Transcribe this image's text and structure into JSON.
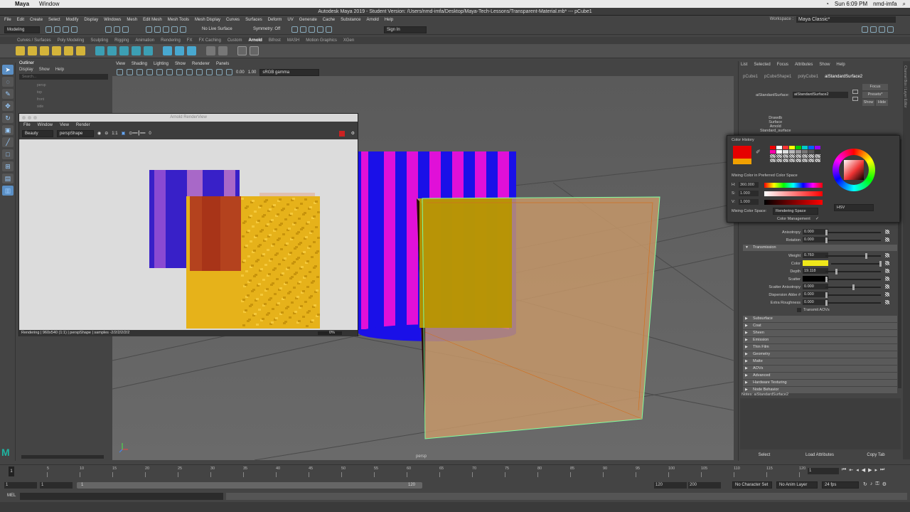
{
  "mac_menu": {
    "apple": "",
    "app": "Maya",
    "window": "Window",
    "clock": "Sun 6:09 PM",
    "user": "nmd-imfa"
  },
  "window_title": "Autodesk Maya 2019 - Student Version: /Users/nmd-imfa/Desktop/Maya-Tech-Lessons/Transparent-Material.mb*  ---  pCube1",
  "main_menu": [
    "File",
    "Edit",
    "Create",
    "Select",
    "Modify",
    "Display",
    "Windows",
    "Mesh",
    "Edit Mesh",
    "Mesh Tools",
    "Mesh Display",
    "Curves",
    "Surfaces",
    "Deform",
    "UV",
    "Generate",
    "Cache",
    "Substance",
    "Arnold",
    "Help"
  ],
  "workspace": {
    "label": "Workspace :",
    "value": "Maya Classic*"
  },
  "status_line": {
    "mode": "Modeling",
    "live_surface": "No Live Surface",
    "symmetry": "Symmetry: Off",
    "sign_in": "Sign In"
  },
  "shelf_tabs": [
    "Curves / Surfaces",
    "Poly Modeling",
    "Sculpting",
    "Rigging",
    "Animation",
    "Rendering",
    "FX",
    "FX Caching",
    "Custom",
    "Arnold",
    "Bifrost",
    "MASH",
    "Motion Graphics",
    "XGen"
  ],
  "shelf_active": "Arnold",
  "outliner": {
    "title": "Outliner",
    "menu": [
      "Display",
      "Show",
      "Help"
    ],
    "search": "Search...",
    "items": [
      "persp",
      "top",
      "front",
      "side"
    ]
  },
  "viewport": {
    "menu": [
      "View",
      "Shading",
      "Lighting",
      "Show",
      "Renderer",
      "Panels"
    ],
    "exposure": "0.00",
    "gamma": "1.00",
    "color_space": "sRGB gamma",
    "camera_label": "persp"
  },
  "render_view": {
    "title": "Arnold RenderView",
    "menu": [
      "File",
      "Window",
      "View",
      "Render"
    ],
    "aov": "Beauty",
    "camera": "perspShape",
    "ratio": "1:1",
    "exposure": "0",
    "status": "Rendering | 960x540 (1:1) | perspShape  | samples -2/2/2/2/2/2",
    "progress": "0%"
  },
  "attribute_editor": {
    "menu": [
      "List",
      "Selected",
      "Focus",
      "Attributes",
      "Show",
      "Help"
    ],
    "tabs": [
      "pCube1",
      "pCubeShape1",
      "polyCube1",
      "aiStandardSurface2"
    ],
    "node_label": "aiStandardSurface:",
    "node_value": "aiStandardSurface2",
    "focus": "Focus",
    "presets": "Presets*",
    "show": "Show",
    "hide": "Hide",
    "classification": [
      "Drawdb",
      "Surface",
      "Arnold",
      "Standard_surface"
    ],
    "anisotropy": {
      "label": "Anisotropy",
      "value": "0.000"
    },
    "rotation": {
      "label": "Rotation",
      "value": "0.000"
    },
    "transmission_title": "Transmission",
    "weight": {
      "label": "Weight",
      "value": "0.760"
    },
    "color": {
      "label": "Color"
    },
    "depth": {
      "label": "Depth",
      "value": "19.118"
    },
    "scatter": {
      "label": "Scatter"
    },
    "scatter_anisotropy": {
      "label": "Scatter Anisotropy",
      "value": "0.000"
    },
    "dispersion": {
      "label": "Dispersion Abbe #",
      "value": "0.000"
    },
    "extra_roughness": {
      "label": "Extra Roughness",
      "value": "0.000"
    },
    "transmit_aovs": "Transmit AOVs",
    "sections": [
      "Subsurface",
      "Coat",
      "Sheen",
      "Emission",
      "Thin Film",
      "Geometry",
      "Matte",
      "AOVs",
      "Advanced",
      "Hardware Texturing",
      "Node Behavior"
    ],
    "notes": "Notes:  aiStandardSurface2",
    "buttons": [
      "Select",
      "Load Attributes",
      "Copy Tab"
    ]
  },
  "color_picker": {
    "history": "Color History",
    "mixing_title": "Mixing Color in Preferred Color Space",
    "h_label": "H:",
    "h_value": "360.000",
    "s_label": "S:",
    "s_value": "1.000",
    "v_label": "V:",
    "v_value": "1.000",
    "mixing_space_label": "Mixing Color Space:",
    "mixing_space": "Rendering Space",
    "management": "Color Management",
    "mode": "HSV"
  },
  "timeline": {
    "current": "1",
    "ticks": [
      "5",
      "10",
      "15",
      "20",
      "25",
      "30",
      "35",
      "40",
      "45",
      "50",
      "55",
      "60",
      "65",
      "70",
      "75",
      "80",
      "85",
      "90",
      "95",
      "100",
      "105",
      "110",
      "115",
      "120"
    ]
  },
  "range": {
    "start": "1",
    "start2": "1",
    "slider_start": "1",
    "slider_end": "120",
    "end": "120",
    "end2": "200",
    "character_set": "No Character Set",
    "anim_layer": "No Anim Layer",
    "fps": "24 fps"
  },
  "mel_label": "MEL",
  "colors": {
    "accent_green": "#5a9a6a",
    "transmission_color": "#f0e81a",
    "render_gold": "#e6b21a"
  }
}
